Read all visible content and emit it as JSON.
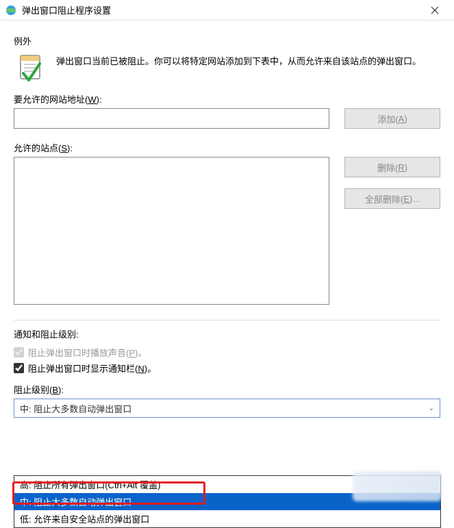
{
  "window": {
    "title": "弹出窗口阻止程序设置"
  },
  "exceptions": {
    "heading": "例外",
    "description": "弹出窗口当前已被阻止。你可以将特定网站添加到下表中，从而允许来自该站点的弹出窗口。",
    "url_label_prefix": "要允许的网站地址(",
    "url_label_key": "W",
    "url_label_suffix": "):",
    "add_button_prefix": "添加(",
    "add_button_key": "A",
    "add_button_suffix": ")",
    "allowed_label_prefix": "允许的站点(",
    "allowed_label_key": "S",
    "allowed_label_suffix": "):",
    "remove_btn_prefix": "删除(",
    "remove_btn_key": "R",
    "remove_btn_suffix": ")",
    "remove_all_btn_prefix": "全部删除(",
    "remove_all_btn_key": "E",
    "remove_all_btn_suffix": ")..."
  },
  "notify": {
    "heading": "通知和阻止级别:",
    "sound_prefix": "阻止弹出窗口时播放声音(",
    "sound_key": "P",
    "sound_suffix": ")。",
    "bar_prefix": "阻止弹出窗口时显示通知栏(",
    "bar_key": "N",
    "bar_suffix": ")。",
    "level_label_prefix": "阻止级别(",
    "level_label_key": "B",
    "level_label_suffix": "):",
    "selected_option": "中: 阻止大多数自动弹出窗口",
    "options": [
      "高: 阻止所有弹出窗口(Ctrl+Alt 覆盖)",
      "中: 阻止大多数自动弹出窗口",
      "低: 允许来自安全站点的弹出窗口"
    ]
  }
}
